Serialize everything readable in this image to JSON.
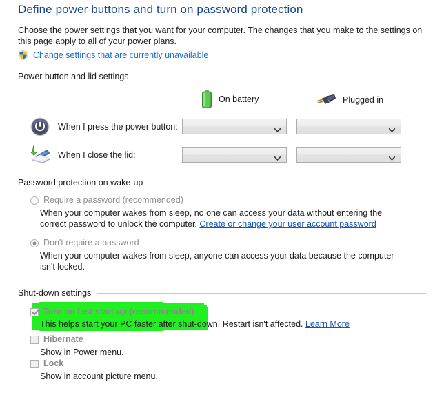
{
  "page": {
    "title": "Define power buttons and turn on password protection",
    "intro": "Choose the power settings that you want for your computer. The changes that you make to the settings on this page apply to all of your power plans.",
    "uac_link": "Change settings that are currently unavailable",
    "uac_icon": "shield-icon"
  },
  "power_lid": {
    "group_caption": "Power button and lid settings",
    "columns": [
      {
        "label": "On battery",
        "icon": "battery-icon"
      },
      {
        "label": "Plugged in",
        "icon": "power-plug-icon"
      }
    ],
    "rows": [
      {
        "label": "When I press the power button:",
        "icon": "power-button-icon",
        "on_battery_value": "",
        "plugged_in_value": ""
      },
      {
        "label": "When I close the lid:",
        "icon": "laptop-lid-icon",
        "on_battery_value": "",
        "plugged_in_value": ""
      }
    ],
    "dropdown_icon": "chevron-down-icon"
  },
  "password_protection": {
    "group_caption": "Password protection on wake-up",
    "options": [
      {
        "label": "Require a password (recommended)",
        "selected": false,
        "description_before_link": "When your computer wakes from sleep, no one can access your data without entering the correct password to unlock the computer. ",
        "link": "Create or change your user account password"
      },
      {
        "label": "Don't require a password",
        "selected": true,
        "description": "When your computer wakes from sleep, anyone can access your data because the computer isn't locked."
      }
    ]
  },
  "shutdown": {
    "group_caption": "Shut-down settings",
    "items": [
      {
        "label": "Turn on fast start-up (recommended)",
        "checked": true,
        "description": "This helps start your PC faster after shut-down. Restart isn't affected. ",
        "link": "Learn More",
        "highlighted": true
      },
      {
        "label": "Hibernate",
        "checked": false,
        "description": "Show in Power menu.",
        "highlighted": false
      },
      {
        "label": "Lock",
        "checked": false,
        "description": "Show in account picture menu.",
        "highlighted": false
      }
    ]
  },
  "colors": {
    "heading": "#17468f",
    "link": "#1555b5",
    "uac_link": "#1a6fd4",
    "highlight": "#22ef22",
    "disabled_text": "#8f8f8f",
    "rule": "#c8c8c8"
  }
}
